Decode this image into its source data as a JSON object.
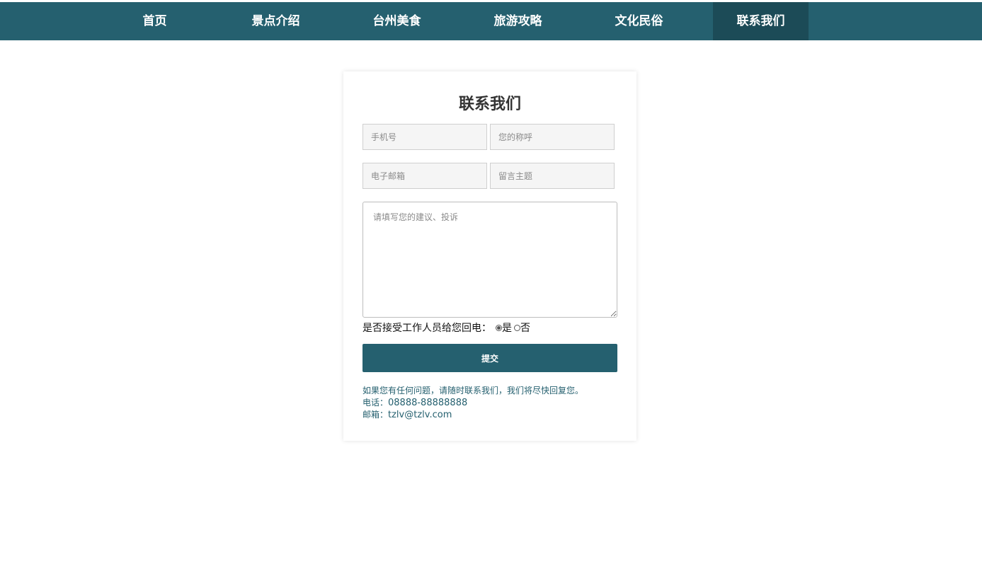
{
  "nav": {
    "items": [
      {
        "label": "首页"
      },
      {
        "label": "景点介绍"
      },
      {
        "label": "台州美食"
      },
      {
        "label": "旅游攻略"
      },
      {
        "label": "文化民俗"
      },
      {
        "label": "联系我们"
      }
    ],
    "active_index": 5
  },
  "form": {
    "title": "联系我们",
    "phone_placeholder": "手机号",
    "name_placeholder": "您的称呼",
    "email_placeholder": "电子邮箱",
    "subject_placeholder": "留言主题",
    "message_placeholder": "请填写您的建议、投诉",
    "callback_label": "是否接受工作人员给您回电：",
    "callback_options": [
      {
        "label": "是",
        "checked": true
      },
      {
        "label": "否",
        "checked": false
      }
    ],
    "submit_label": "提交"
  },
  "info": {
    "note": "如果您有任何问题，请随时联系我们，我们将尽快回复您。",
    "phone_label": "电话：",
    "phone_value": "08888-88888888",
    "email_label": "邮箱：",
    "email_value": "tzlv@tzlv.com"
  },
  "colors": {
    "brand": "#25606f",
    "brand_dark": "#1c4b57"
  }
}
